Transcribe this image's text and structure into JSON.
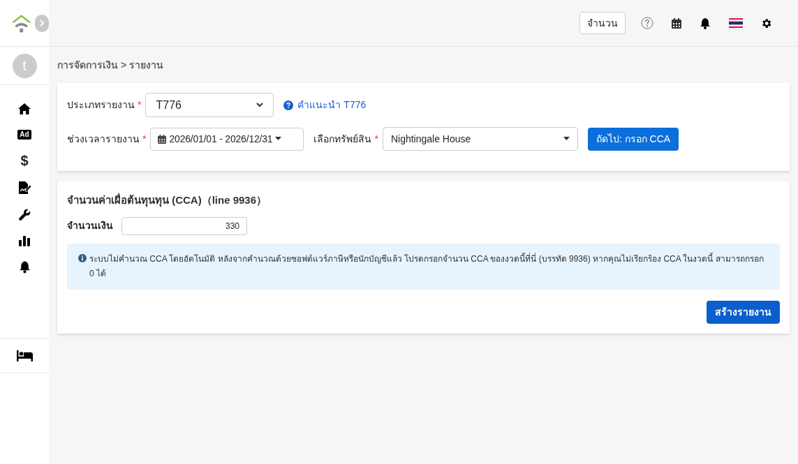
{
  "sidebar": {
    "avatar": "t",
    "items": [
      {
        "kind": "home"
      },
      {
        "kind": "ad",
        "text": "Ad"
      },
      {
        "kind": "dollar",
        "text": "$"
      },
      {
        "kind": "sign"
      },
      {
        "kind": "wrench"
      },
      {
        "kind": "chart"
      },
      {
        "kind": "bell"
      }
    ],
    "bottom_items": [
      {
        "kind": "bed"
      }
    ]
  },
  "topbar": {
    "count_button": "จำนวน"
  },
  "breadcrumb": "การจัดการเงิน > รายงาน",
  "filters": {
    "required_marks": [
      "*",
      "*",
      "*"
    ],
    "report_type_label": "ประเภทรายงาน",
    "report_type": "T776",
    "guide_link": "คำแนะนำ T776",
    "period_label": "ช่วงเวลารายงาน",
    "period": "2026/01/01 - 2026/12/31",
    "asset_label": "เลือกทรัพย์สิน",
    "asset": "Nightingale House",
    "next_button": "ถัดไป: กรอก CCA"
  },
  "cca": {
    "title": "จำนวนค่าเผื่อต้นทุนทุน (CCA)（line 9936）",
    "amount_label": "จำนวนเงิน",
    "amount": "330",
    "info": "ระบบไม่คำนวณ CCA โดยอัตโนมัติ หลังจากคำนวณด้วยซอฟต์แวร์ภาษีหรือนักบัญชีแล้ว โปรดกรอกจำนวน CCA ของงวดนี้ที่นี่ (บรรทัด 9936) หากคุณไม่เรียกร้อง CCA ในงวดนี้ สามารถกรอก 0 ได้",
    "create_button": "สร้างรายงาน"
  }
}
